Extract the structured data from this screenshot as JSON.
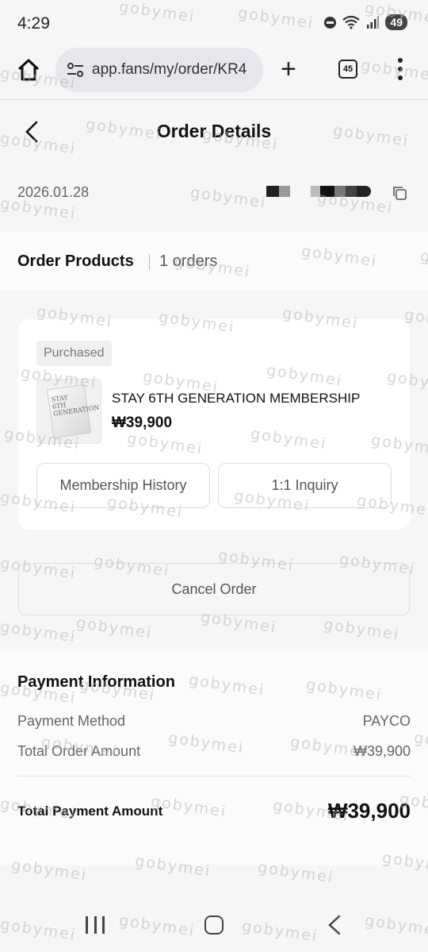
{
  "status_bar": {
    "time": "4:29",
    "battery": "49"
  },
  "browser": {
    "url": "app.fans/my/order/KR4",
    "tab_count": "45"
  },
  "header": {
    "title": "Order Details"
  },
  "order": {
    "date": "2026.01.28"
  },
  "products_section": {
    "title": "Order Products",
    "count": "1 orders"
  },
  "product": {
    "status_badge": "Purchased",
    "name": "STAY 6TH GENERATION MEMBERSHIP",
    "price": "₩39,900",
    "thumbnail_text": "STAY 6TH GENERATION",
    "buttons": {
      "history": "Membership History",
      "inquiry": "1:1 Inquiry"
    }
  },
  "cancel_button": "Cancel Order",
  "payment": {
    "title": "Payment Information",
    "method_label": "Payment Method",
    "method_value": "PAYCO",
    "total_order_label": "Total Order Amount",
    "total_order_value": "₩39,900",
    "total_payment_label": "Total Payment Amount",
    "total_payment_value": "₩39,900"
  },
  "watermark": "gobymei",
  "icons": {
    "home": "home-icon",
    "site_settings": "tune-icon",
    "plus": "plus-icon",
    "tabs": "tabs-icon",
    "menu": "more-vertical-icon",
    "back": "chevron-left-icon",
    "copy": "copy-icon",
    "nav_recent": "recent-apps-icon",
    "nav_home": "home-circle-icon",
    "nav_back": "nav-back-icon",
    "dnd": "do-not-disturb-icon",
    "wifi": "wifi-icon",
    "signal": "signal-icon"
  }
}
